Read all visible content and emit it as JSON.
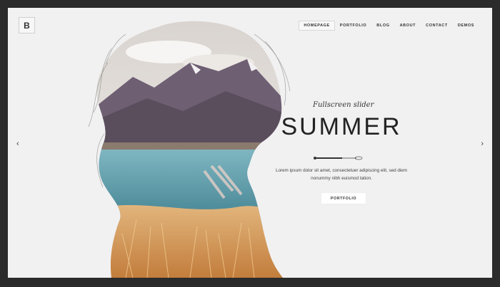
{
  "logo": {
    "letter": "B"
  },
  "nav": {
    "items": [
      {
        "label": "HOMEPAGE",
        "active": true
      },
      {
        "label": "PORTFOLIO",
        "active": false
      },
      {
        "label": "BLOG",
        "active": false
      },
      {
        "label": "ABOUT",
        "active": false
      },
      {
        "label": "CONTACT",
        "active": false
      },
      {
        "label": "DEMOS",
        "active": false
      }
    ]
  },
  "slider": {
    "prev_icon": "chevron-left-icon",
    "next_icon": "chevron-right-icon",
    "prev_glyph": "‹",
    "next_glyph": "›"
  },
  "hero": {
    "subtitle": "Fullscreen slider",
    "title": "SUMMER",
    "description_line1": "Lorem ipsum dolor sit amet, consectetuer adipiscing elit, sed diem",
    "description_line2": "nonummy nibh euismod tation.",
    "button_label": "PORTFOLIO"
  },
  "colors": {
    "background": "#f1f1f2",
    "frame": "#2b2b2b",
    "text": "#222222",
    "sky": "#e8e5e2",
    "mountain": "#6e5f73",
    "lake": "#4f8e9c",
    "grass": "#d49a5a"
  }
}
